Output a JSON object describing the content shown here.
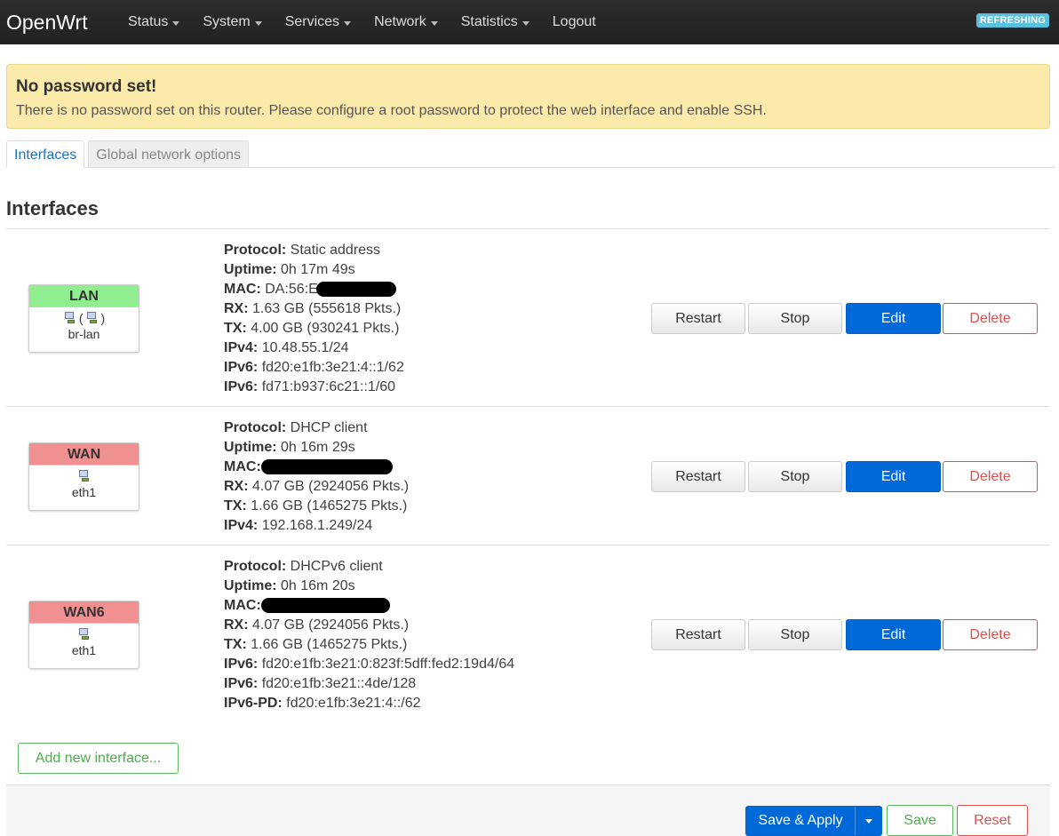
{
  "header": {
    "brand": "OpenWrt",
    "menu": [
      {
        "label": "Status",
        "dropdown": true
      },
      {
        "label": "System",
        "dropdown": true
      },
      {
        "label": "Services",
        "dropdown": true
      },
      {
        "label": "Network",
        "dropdown": true
      },
      {
        "label": "Statistics",
        "dropdown": true
      },
      {
        "label": "Logout",
        "dropdown": false
      }
    ],
    "refresh_badge": "REFRESHING"
  },
  "alert": {
    "title": "No password set!",
    "message": "There is no password set on this router. Please configure a root password to protect the web interface and enable SSH."
  },
  "tabs": [
    {
      "label": "Interfaces",
      "active": true
    },
    {
      "label": "Global network options",
      "active": false
    }
  ],
  "section_title": "Interfaces",
  "interfaces": [
    {
      "name": "LAN",
      "color": "#90ee90",
      "icons": [
        "bridge-icon",
        "ethernet-icon"
      ],
      "device": "br-lan",
      "paren_open": "(",
      "paren_close": ")",
      "details": [
        {
          "label": "Protocol:",
          "value": "Static address"
        },
        {
          "label": "Uptime:",
          "value": "0h 17m 49s"
        },
        {
          "label": "MAC:",
          "value": "DA:56:E",
          "redacted": true
        },
        {
          "label": "RX:",
          "value": "1.63 GB (555618 Pkts.)"
        },
        {
          "label": "TX:",
          "value": "4.00 GB (930241 Pkts.)"
        },
        {
          "label": "IPv4:",
          "value": "10.48.55.1/24"
        },
        {
          "label": "IPv6:",
          "value": "fd20:e1fb:3e21:4::1/62"
        },
        {
          "label": "IPv6:",
          "value": "fd71:b937:6c21::1/60"
        }
      ]
    },
    {
      "name": "WAN",
      "color": "#f09090",
      "icons": [
        "ethernet-icon"
      ],
      "device": "eth1",
      "details": [
        {
          "label": "Protocol:",
          "value": "DHCP client"
        },
        {
          "label": "Uptime:",
          "value": "0h 16m 29s"
        },
        {
          "label": "MAC:",
          "value": "",
          "redacted": true
        },
        {
          "label": "RX:",
          "value": "4.07 GB (2924056 Pkts.)"
        },
        {
          "label": "TX:",
          "value": "1.66 GB (1465275 Pkts.)"
        },
        {
          "label": "IPv4:",
          "value": "192.168.1.249/24"
        }
      ]
    },
    {
      "name": "WAN6",
      "color": "#f09090",
      "icons": [
        "ethernet-icon"
      ],
      "device": "eth1",
      "details": [
        {
          "label": "Protocol:",
          "value": "DHCPv6 client"
        },
        {
          "label": "Uptime:",
          "value": "0h 16m 20s"
        },
        {
          "label": "MAC:",
          "value": "",
          "redacted": true
        },
        {
          "label": "RX:",
          "value": "4.07 GB (2924056 Pkts.)"
        },
        {
          "label": "TX:",
          "value": "1.66 GB (1465275 Pkts.)"
        },
        {
          "label": "IPv6:",
          "value": "fd20:e1fb:3e21:0:823f:5dff:fed2:19d4/64"
        },
        {
          "label": "IPv6:",
          "value": "fd20:e1fb:3e21::4de/128"
        },
        {
          "label": "IPv6-PD:",
          "value": "fd20:e1fb:3e21:4::/62"
        }
      ]
    }
  ],
  "row_buttons": {
    "restart": "Restart",
    "stop": "Stop",
    "edit": "Edit",
    "delete": "Delete"
  },
  "add_interface": "Add new interface...",
  "footer": {
    "save_apply": "Save & Apply",
    "save": "Save",
    "reset": "Reset"
  },
  "colors": {
    "primary": "#0069d9",
    "danger": "#d9534f",
    "success": "#5cb85c",
    "alert_bg": "#fbeaa9"
  }
}
